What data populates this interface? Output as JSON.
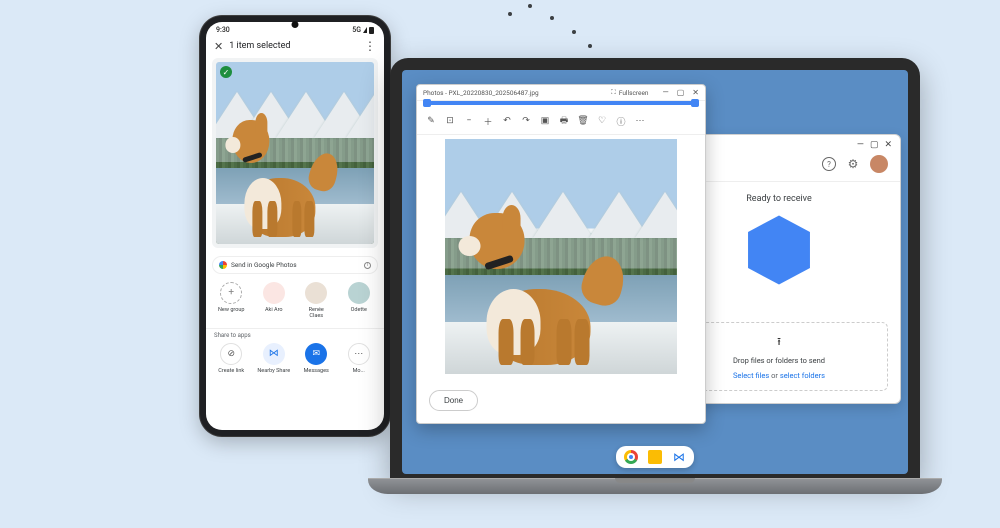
{
  "phone": {
    "status": {
      "time": "9:30",
      "network": "5G"
    },
    "header": {
      "title": "1 item selected"
    },
    "sendRow": {
      "label": "Send in Google Photos"
    },
    "contacts": [
      {
        "label": "New group"
      },
      {
        "label": "Aki Aro"
      },
      {
        "label": "Renée\nClaes"
      },
      {
        "label": "Odette"
      }
    ],
    "shareLabel": "Share to apps",
    "apps": [
      {
        "label": "Create link"
      },
      {
        "label": "Nearby Share"
      },
      {
        "label": "Messages"
      },
      {
        "label": "Mo..."
      }
    ]
  },
  "photosViewer": {
    "title": "Photos - PXL_20220830_202506487.jpg",
    "fullscreen": "Fullscreen",
    "doneLabel": "Done"
  },
  "nearbyShare": {
    "status": "Ready to receive",
    "dropLabel": "Drop files or folders to send",
    "selectFiles": "Select files",
    "or": "or",
    "selectFolders": "select folders"
  }
}
